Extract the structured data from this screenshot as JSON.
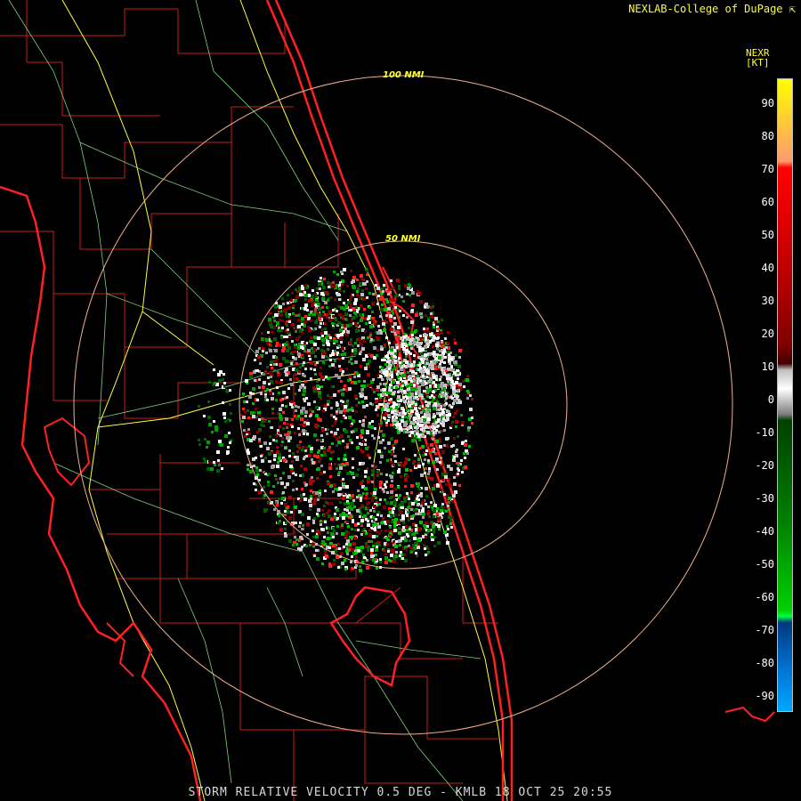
{
  "header": {
    "credit": "NEXLAB-College of DuPage",
    "credit_icon": "cursor-arrow-icon"
  },
  "product": {
    "title": "STORM RELATIVE VELOCITY 0.5 DEG - KMLB 18 OCT 25 20:55"
  },
  "legend": {
    "title": "NEXR",
    "unit": "[KT]",
    "ticks": [
      "90",
      "80",
      "70",
      "60",
      "50",
      "40",
      "30",
      "20",
      "10",
      "0",
      "-10",
      "-20",
      "-30",
      "-40",
      "-50",
      "-60",
      "-70",
      "-80",
      "-90"
    ]
  },
  "range_rings": [
    {
      "label": "100 NMI",
      "range_nmi": 100
    },
    {
      "label": "50 NMI",
      "range_nmi": 50
    }
  ],
  "colors": {
    "coast": "#ff2020",
    "county": "#c81e1e",
    "highway": "#ffff40",
    "road": "#7fd07f",
    "ring": "#f0b090",
    "legend_text": "#ffff33"
  }
}
